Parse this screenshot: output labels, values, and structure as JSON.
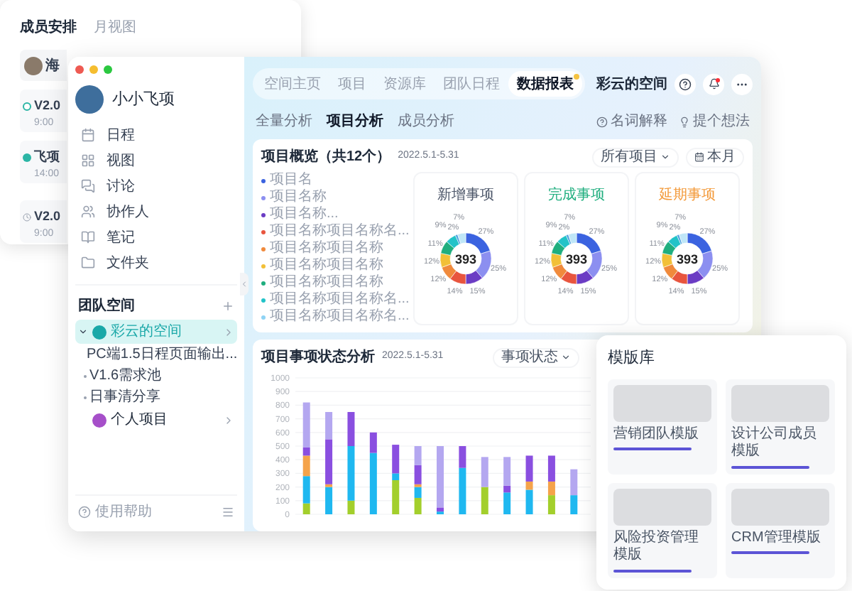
{
  "back_window": {
    "tabs": [
      {
        "label": "成员安排",
        "selected": true
      },
      {
        "label": "月视图",
        "selected": false
      }
    ],
    "items": [
      {
        "kind": "person",
        "title": "海"
      },
      {
        "kind": "task",
        "checked": false,
        "title": "V2.0",
        "time": "9:00"
      },
      {
        "kind": "task",
        "checked": true,
        "title": "飞项",
        "time": "14:00"
      },
      {
        "kind": "event",
        "title": "V2.0",
        "time": "9:00"
      }
    ]
  },
  "sidebar": {
    "user": "小小飞项",
    "nav": [
      "日程",
      "视图",
      "讨论",
      "协作人",
      "笔记",
      "文件夹"
    ],
    "team_title": "团队空间",
    "spaces": [
      {
        "label": "彩云的空间",
        "color": "#1aa8a8",
        "selected": true,
        "expanded": true,
        "children": [
          "PC端1.5日程页面输出...",
          "V1.6需求池",
          "日事清分享"
        ]
      },
      {
        "label": "个人项目",
        "color": "#a64fc9",
        "selected": false,
        "expanded": false
      }
    ],
    "help": "使用帮助"
  },
  "top_tabs": [
    {
      "label": "空间主页",
      "selected": false,
      "notify": false
    },
    {
      "label": "项目",
      "selected": false,
      "notify": false
    },
    {
      "label": "资源库",
      "selected": false,
      "notify": false
    },
    {
      "label": "团队日程",
      "selected": false,
      "notify": false
    },
    {
      "label": "数据报表",
      "selected": true,
      "notify": true
    }
  ],
  "space_name": "彩云的空间",
  "bell_notify": true,
  "sub_tabs": [
    {
      "label": "全量分析",
      "selected": false
    },
    {
      "label": "项目分析",
      "selected": true
    },
    {
      "label": "成员分析",
      "selected": false
    }
  ],
  "links": [
    "名词解释",
    "提个想法"
  ],
  "overview": {
    "title": "项目概览（共12个）",
    "date": "2022.5.1-5.31",
    "filter": "所有项目",
    "period": "本月",
    "legend": [
      {
        "label": "项目名",
        "color": "#3b63e0"
      },
      {
        "label": "项目名称",
        "color": "#8c8ff0"
      },
      {
        "label": "项目名称...",
        "color": "#6b3cc4"
      },
      {
        "label": "项目名称项目名称名...",
        "color": "#e8553e"
      },
      {
        "label": "项目名称项目名称",
        "color": "#f08a3c"
      },
      {
        "label": "项目名称项目名称",
        "color": "#f2c037"
      },
      {
        "label": "项目名称项目名称",
        "color": "#1fae7e"
      },
      {
        "label": "项目名称项目名称名...",
        "color": "#22c3c8"
      },
      {
        "label": "项目名称项目名称名...",
        "color": "#8fd3f4"
      }
    ],
    "cards": [
      {
        "title": "新增事项",
        "color": "#4b5568",
        "total": "393",
        "chart_data": {
          "type": "donut",
          "values": [
            27,
            25,
            15,
            14,
            12,
            12,
            11,
            9,
            2,
            7
          ],
          "value_labels": [
            "27%",
            "25%",
            "15%",
            "14%",
            "12%",
            "12%",
            "11%",
            "9%",
            "2%",
            "7%"
          ]
        }
      },
      {
        "title": "完成事项",
        "color": "#1fae7e",
        "total": "393",
        "chart_data": {
          "type": "donut",
          "values": [
            27,
            25,
            15,
            14,
            12,
            12,
            11,
            9,
            2,
            7
          ],
          "value_labels": [
            "27%",
            "25%",
            "15%",
            "14%",
            "12%",
            "12%",
            "11%",
            "9%",
            "2%",
            "7%"
          ]
        }
      },
      {
        "title": "延期事项",
        "color": "#f39a3a",
        "total": "393",
        "chart_data": {
          "type": "donut",
          "values": [
            27,
            25,
            15,
            14,
            12,
            12,
            11,
            9,
            2,
            7
          ],
          "value_labels": [
            "27%",
            "25%",
            "15%",
            "14%",
            "12%",
            "12%",
            "11%",
            "9%",
            "2%",
            "7%"
          ]
        }
      }
    ]
  },
  "status": {
    "title": "项目事项状态分析",
    "date": "2022.5.1-5.31",
    "filter": "事项状态",
    "chart_data": {
      "type": "bar",
      "stacked": true,
      "grid": true,
      "ylim": [
        0,
        1000
      ],
      "yticks": [
        0,
        100,
        200,
        300,
        400,
        500,
        600,
        700,
        800,
        900,
        1000
      ],
      "series": [
        {
          "color": "#a3cf2c",
          "values": [
            80,
            0,
            100,
            0,
            250,
            120,
            0,
            0,
            200,
            0,
            0,
            140,
            0
          ]
        },
        {
          "color": "#1fb8f0",
          "values": [
            200,
            200,
            400,
            450,
            50,
            80,
            20,
            340,
            0,
            160,
            180,
            0,
            140
          ]
        },
        {
          "color": "#f5a34a",
          "values": [
            150,
            20,
            0,
            0,
            0,
            20,
            0,
            0,
            0,
            0,
            60,
            100,
            0
          ]
        },
        {
          "color": "#8a4fe0",
          "values": [
            60,
            330,
            250,
            150,
            210,
            140,
            30,
            160,
            0,
            50,
            190,
            190,
            0
          ]
        },
        {
          "color": "#b4a7f0",
          "values": [
            330,
            200,
            0,
            0,
            0,
            140,
            450,
            0,
            220,
            210,
            0,
            0,
            190
          ]
        }
      ]
    }
  },
  "templates": {
    "title": "模版库",
    "items": [
      "营销团队模版",
      "设计公司成员模版",
      "风险投资管理模版",
      "CRM管理模版"
    ]
  }
}
